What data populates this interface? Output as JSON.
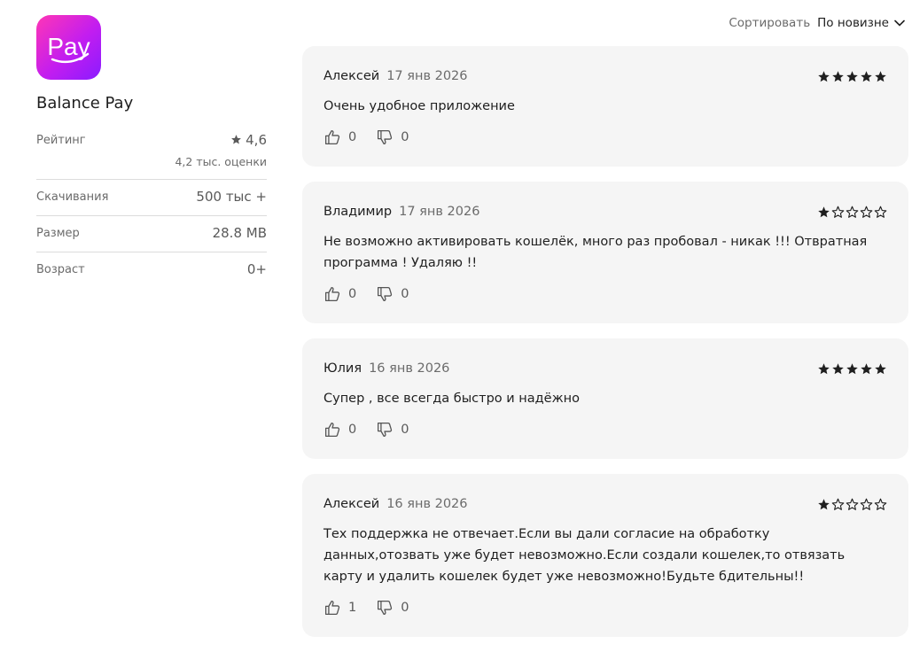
{
  "app": {
    "icon_text": "Pay",
    "name": "Balance Pay",
    "rating_label": "Рейтинг",
    "rating_value": "4,6",
    "rating_count": "4,2 тыс. оценки",
    "downloads_label": "Скачивания",
    "downloads_value": "500 тыс +",
    "size_label": "Размер",
    "size_value": "28.8 MB",
    "age_label": "Возраст",
    "age_value": "0+"
  },
  "sort": {
    "label": "Сортировать",
    "value": "По новизне"
  },
  "reviews": [
    {
      "author": "Алексей",
      "date": "17 янв 2026",
      "rating": 5,
      "text": "Очень удобное приложение",
      "likes": "0",
      "dislikes": "0"
    },
    {
      "author": "Владимир",
      "date": "17 янв 2026",
      "rating": 1,
      "text": "Не возможно активировать кошелёк, много раз пробовал - никак !!! Отвратная программа ! Удаляю !!",
      "likes": "0",
      "dislikes": "0"
    },
    {
      "author": "Юлия",
      "date": "16 янв 2026",
      "rating": 5,
      "text": "Супер , все всегда быстро и надёжно",
      "likes": "0",
      "dislikes": "0"
    },
    {
      "author": "Алексей",
      "date": "16 янв 2026",
      "rating": 1,
      "text": "Тех поддержка не отвечает.Если вы дали согласие на обработку данных,отозвать уже будет невозможно.Если создали кошелек,то отвязать карту и удалить кошелек будет уже невозможно!Будьте бдительны!!",
      "likes": "1",
      "dislikes": "0"
    }
  ],
  "colors": {
    "icon_gradient_start": "#ff36b5",
    "icon_gradient_end": "#8a1cff",
    "card_bg": "#f5f5f5"
  }
}
